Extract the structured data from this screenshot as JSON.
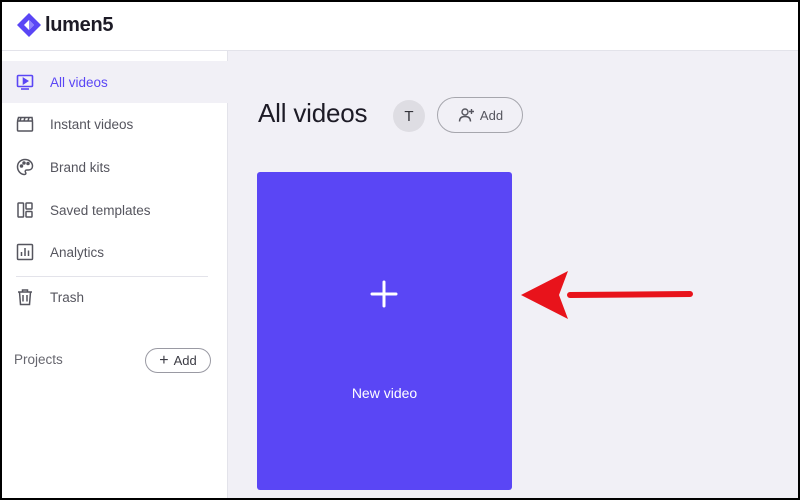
{
  "brand": {
    "name": "lumen5",
    "color": "#5a46f5"
  },
  "sidebar": {
    "items": [
      {
        "label": "All videos",
        "icon": "play-screen-icon",
        "active": true
      },
      {
        "label": "Instant videos",
        "icon": "clapperboard-icon",
        "active": false
      },
      {
        "label": "Brand kits",
        "icon": "palette-icon",
        "active": false
      },
      {
        "label": "Saved templates",
        "icon": "template-layout-icon",
        "active": false
      },
      {
        "label": "Analytics",
        "icon": "bar-chart-icon",
        "active": false
      },
      {
        "label": "Trash",
        "icon": "trash-icon",
        "active": false
      }
    ],
    "projects_label": "Projects",
    "projects_add_label": "Add"
  },
  "main": {
    "title": "All videos",
    "avatar_initial": "T",
    "add_member_label": "Add",
    "new_video_label": "New video"
  },
  "annotation": {
    "arrow_color": "#e8131b"
  }
}
